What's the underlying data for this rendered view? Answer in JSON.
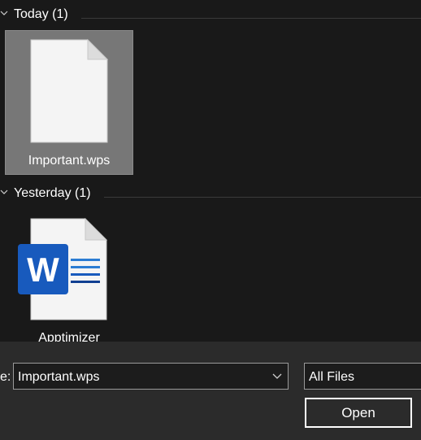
{
  "groups": [
    {
      "title": "Today (1)",
      "files": [
        {
          "name": "Important.wps",
          "icon": "blank-document-icon",
          "selected": true
        }
      ]
    },
    {
      "title": "Yesterday (1)",
      "files": [
        {
          "name": "Apptimizer",
          "icon": "word-document-icon",
          "selected": false
        }
      ]
    }
  ],
  "footer": {
    "filename_label": "e:",
    "filename_value": "Important.wps",
    "file_type": "All Files",
    "open_label": "Open"
  },
  "colors": {
    "background": "#191919",
    "selection": "#777777",
    "panel": "#2b2b2b",
    "word_blue": "#185abd"
  }
}
